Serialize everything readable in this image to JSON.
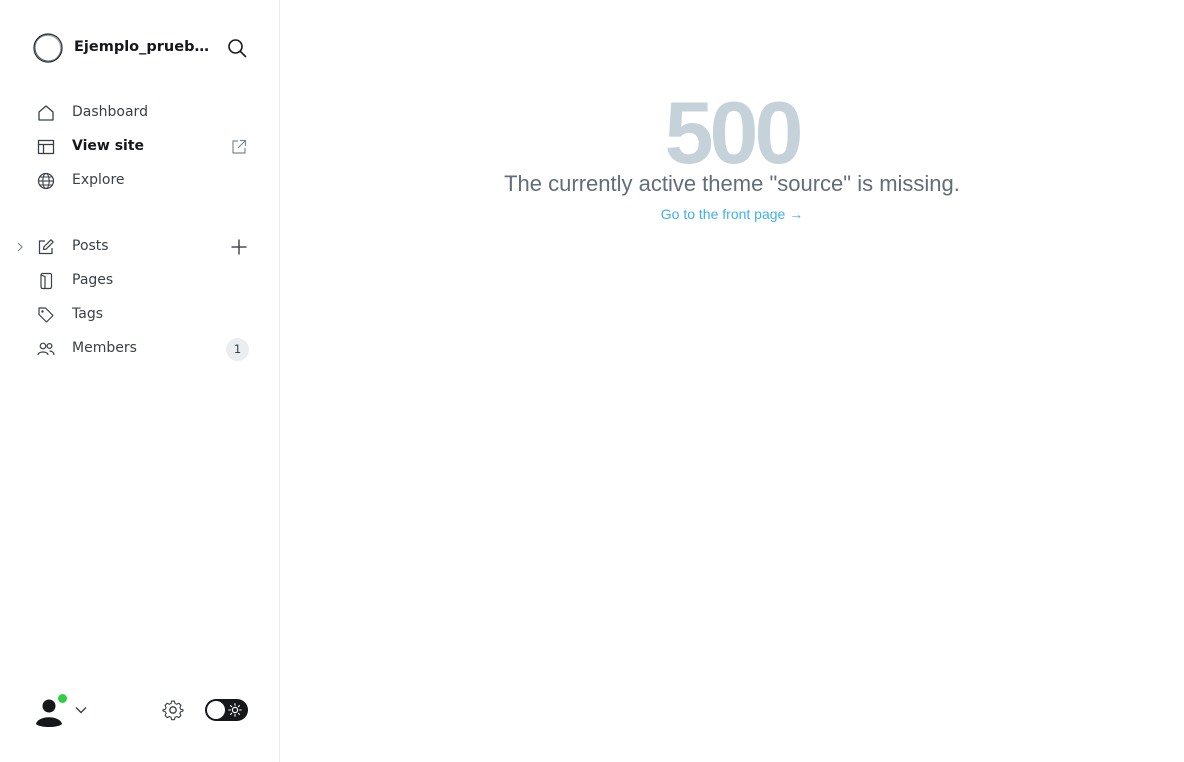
{
  "sidebar": {
    "site_title": "Ejemplo_prueba...",
    "nav_primary": [
      {
        "label": "Dashboard",
        "icon": "home-icon"
      },
      {
        "label": "View site",
        "icon": "layout-icon",
        "right_icon": "external-link-icon",
        "active": true
      },
      {
        "label": "Explore",
        "icon": "globe-icon"
      }
    ],
    "nav_secondary": [
      {
        "label": "Posts",
        "icon": "pen-icon",
        "right_icon": "plus-icon",
        "expand_icon": "chevron-right-icon"
      },
      {
        "label": "Pages",
        "icon": "pages-icon"
      },
      {
        "label": "Tags",
        "icon": "tag-icon"
      },
      {
        "label": "Members",
        "icon": "members-icon",
        "badge": "1"
      }
    ],
    "footer": {
      "avatar_icon": "user-avatar-icon",
      "status": "online",
      "status_color": "#30cf43",
      "settings_icon": "gear-icon",
      "theme_toggle_icon": "sun-icon"
    }
  },
  "main": {
    "error_code": "500",
    "error_message": "The currently active theme \"source\" is missing.",
    "link_text": "Go to the front page →"
  },
  "colors": {
    "error_code": "#c5d2d9",
    "link": "#3eb0ef",
    "badge_bg": "#ebeef0",
    "text": "#15171a"
  }
}
